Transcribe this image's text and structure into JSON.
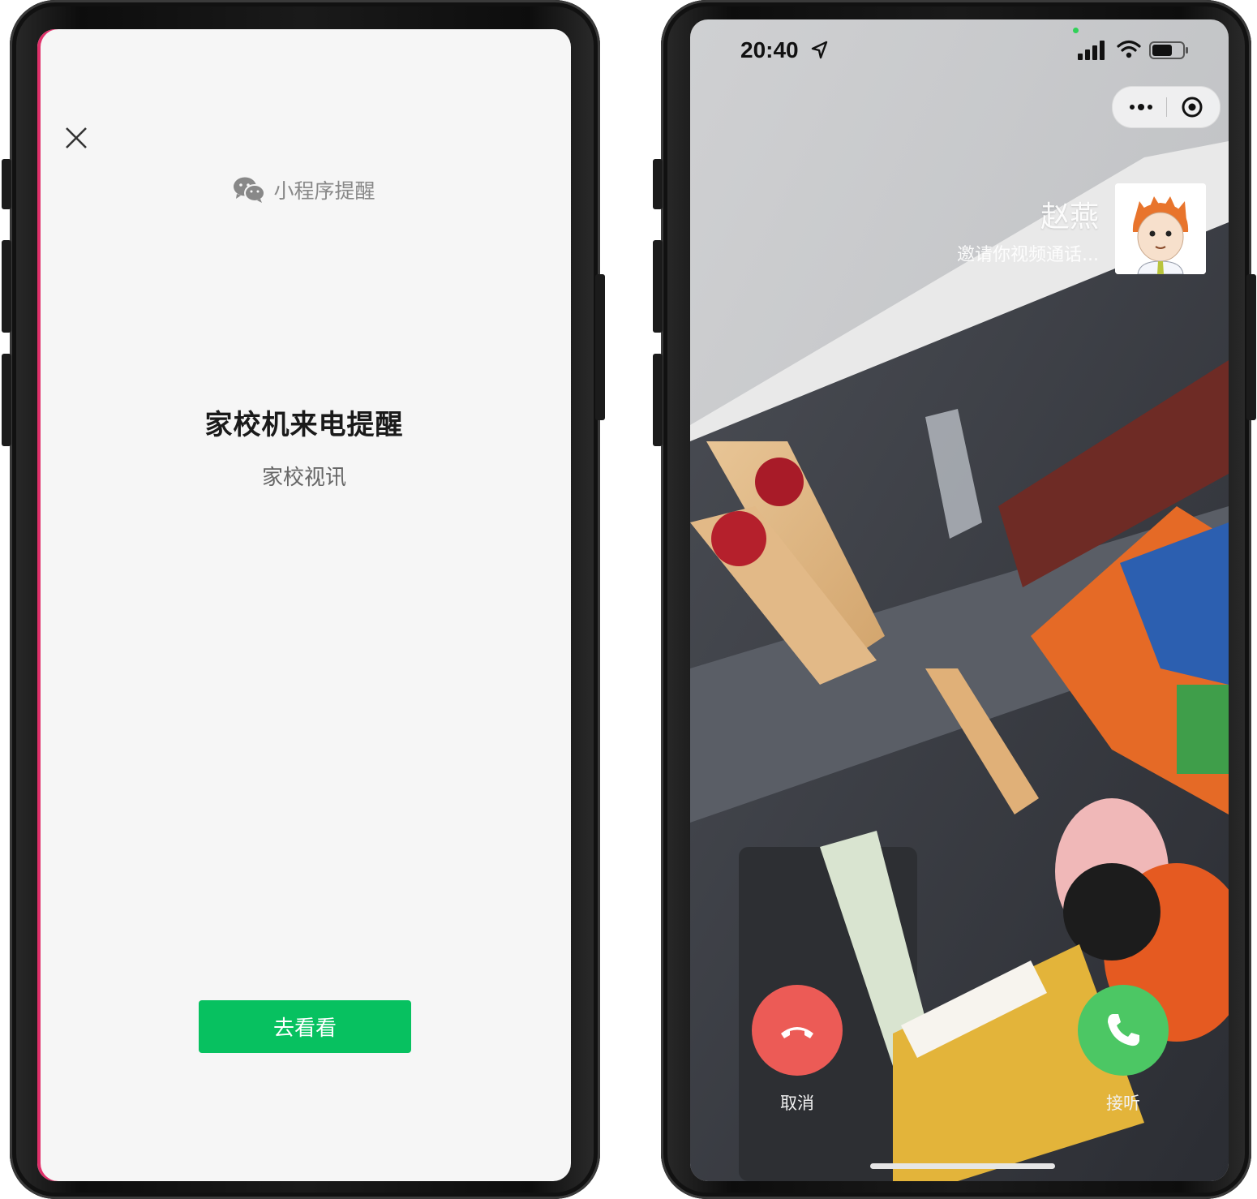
{
  "left": {
    "close_icon": "close-icon",
    "header_icon": "wechat-icon",
    "header_label": "小程序提醒",
    "title": "家校机来电提醒",
    "subtitle": "家校视讯",
    "button_label": "去看看",
    "button_color": "#07c160"
  },
  "right": {
    "status": {
      "time": "20:40",
      "location_icon": "location-arrow-icon",
      "signal_icon": "signal-icon",
      "wifi_icon": "wifi-icon",
      "battery_icon": "battery-icon"
    },
    "capsule": {
      "more_icon": "more-icon",
      "close_icon": "target-icon"
    },
    "caller": {
      "name": "赵燕",
      "description": "邀请你视频通话..."
    },
    "actions": {
      "cancel_label": "取消",
      "accept_label": "接听",
      "cancel_color": "#ec5b56",
      "accept_color": "#4cc764"
    }
  }
}
